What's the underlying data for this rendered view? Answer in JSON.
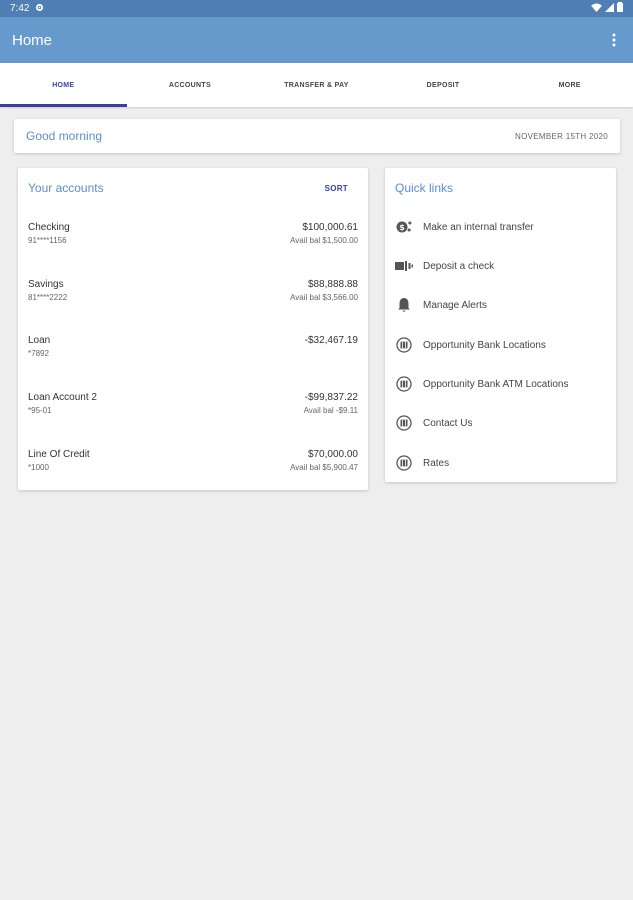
{
  "status_bar": {
    "time": "7:42"
  },
  "app_bar": {
    "title": "Home"
  },
  "tabs": [
    {
      "label": "HOME"
    },
    {
      "label": "ACCOUNTS"
    },
    {
      "label": "TRANSFER & PAY"
    },
    {
      "label": "DEPOSIT"
    },
    {
      "label": "MORE"
    }
  ],
  "greeting": {
    "text": "Good morning",
    "date": "NOVEMBER 15TH 2020"
  },
  "accounts": {
    "title": "Your accounts",
    "sort_label": "SORT",
    "items": [
      {
        "name": "Checking",
        "number": "91****1156",
        "amount": "$100,000.61",
        "avail": "Avail bal $1,500.00"
      },
      {
        "name": "Savings",
        "number": "81****2222",
        "amount": "$88,888.88",
        "avail": "Avail bal $3,566.00"
      },
      {
        "name": "Loan",
        "number": "*7892",
        "amount": "-$32,467.19",
        "avail": ""
      },
      {
        "name": "Loan Account 2",
        "number": "*95-01",
        "amount": "-$99,837.22",
        "avail": "Avail bal -$9.11"
      },
      {
        "name": "Line Of Credit",
        "number": "*1000",
        "amount": "$70,000.00",
        "avail": "Avail bal $5,900.47"
      }
    ]
  },
  "quick_links": {
    "title": "Quick links",
    "items": [
      {
        "label": "Make an internal transfer",
        "icon": "transfer-icon"
      },
      {
        "label": "Deposit a check",
        "icon": "check-deposit-icon"
      },
      {
        "label": "Manage Alerts",
        "icon": "bell-icon"
      },
      {
        "label": "Opportunity Bank Locations",
        "icon": "map-icon"
      },
      {
        "label": "Opportunity Bank ATM Locations",
        "icon": "map-icon"
      },
      {
        "label": "Contact Us",
        "icon": "map-icon"
      },
      {
        "label": "Rates",
        "icon": "map-icon"
      }
    ]
  },
  "colors": {
    "status_bar": "#4f7fb4",
    "app_bar": "#6699cc",
    "accent": "#3a3f9e",
    "heading_blue": "#5b8fc8",
    "background": "#eeeeee"
  }
}
